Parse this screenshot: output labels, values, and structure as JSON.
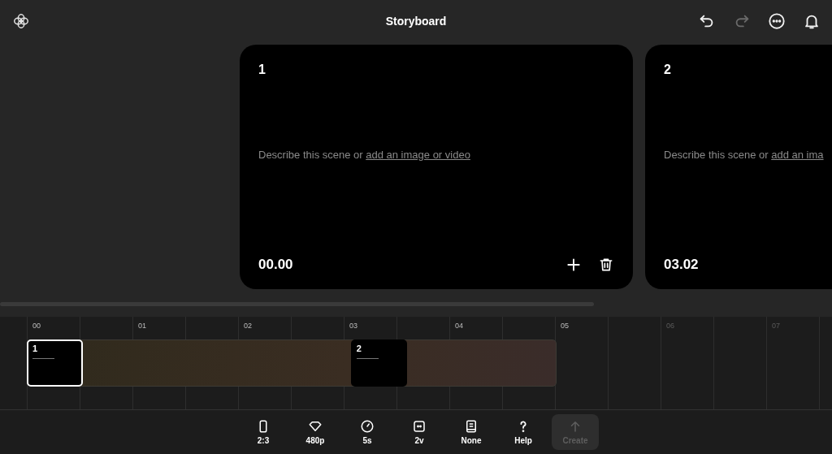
{
  "header": {
    "title": "Storyboard",
    "actions": [
      {
        "kind": "undo",
        "disabled": false
      },
      {
        "kind": "redo",
        "disabled": true
      },
      {
        "kind": "more",
        "disabled": false
      },
      {
        "kind": "bell",
        "disabled": false
      }
    ]
  },
  "scenes": [
    {
      "number": "1",
      "prompt": "Describe this scene or",
      "link": "add an image or video",
      "time": "00.00",
      "actions": true
    },
    {
      "number": "2",
      "prompt": "Describe this scene or",
      "link": "add an ima",
      "time": "03.02",
      "actions": false
    }
  ],
  "timeline": {
    "ruler": [
      {
        "label": "00",
        "faded": false
      },
      {
        "label": "01",
        "faded": false
      },
      {
        "label": "02",
        "faded": false
      },
      {
        "label": "03",
        "faded": false
      },
      {
        "label": "04",
        "faded": false
      },
      {
        "label": "05",
        "faded": false
      },
      {
        "label": "06",
        "faded": true
      },
      {
        "label": "07",
        "faded": true
      }
    ],
    "clips": [
      {
        "label": "1",
        "selected": true
      },
      {
        "label": "2",
        "selected": false
      }
    ]
  },
  "toolbar": [
    {
      "kind": "aspect",
      "label": "2:3"
    },
    {
      "kind": "quality",
      "label": "480p"
    },
    {
      "kind": "duration",
      "label": "5s"
    },
    {
      "kind": "variations",
      "label": "2v"
    },
    {
      "kind": "preset",
      "label": "None"
    },
    {
      "kind": "help",
      "label": "Help"
    }
  ],
  "create": {
    "label": "Create",
    "disabled": true
  }
}
